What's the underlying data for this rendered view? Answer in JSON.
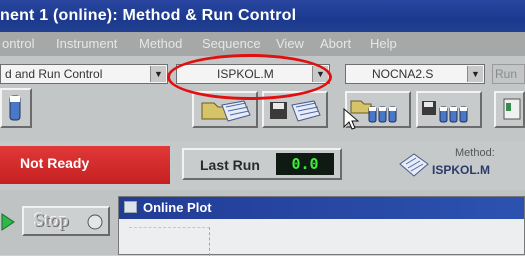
{
  "titlebar": {
    "text": "nent 1 (online): Method & Run Control"
  },
  "menu": {
    "items": [
      "ontrol",
      "Instrument",
      "Method",
      "Sequence",
      "View",
      "Abort",
      "Help"
    ]
  },
  "toolbar": {
    "view_combo": "d and Run Control",
    "method_combo": "ISPKOL.M",
    "sequence_combo": "NOCNA2.S",
    "run_label": "Run"
  },
  "status": {
    "state": "Not Ready",
    "last_run_label": "Last Run",
    "last_run_value": "0.0",
    "method_caption": "Method:",
    "method_name": "ISPKOL.M"
  },
  "controls": {
    "stop_label": "Stop"
  },
  "online_plot": {
    "title": "Online Plot"
  },
  "colors": {
    "title_blue": "#1b3a8f",
    "not_ready_red": "#d12a2a",
    "highlight_red": "#e01010",
    "led_green": "#38ef38"
  }
}
